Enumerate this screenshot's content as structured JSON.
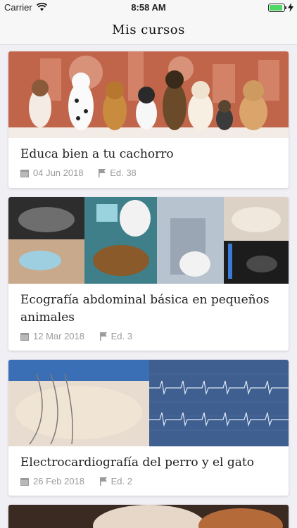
{
  "status": {
    "carrier": "Carrier",
    "time": "8:58 AM",
    "battery_level": 0.9
  },
  "nav": {
    "title": "Mis cursos"
  },
  "courses": [
    {
      "title": "Educa bien a tu cachorro",
      "date": "04 Jun 2018",
      "edition": "Ed. 38"
    },
    {
      "title": "Ecografía abdominal básica en pequeños animales",
      "date": "12 Mar 2018",
      "edition": "Ed. 3"
    },
    {
      "title": "Electrocardiografía del perro y el gato",
      "date": "26 Feb 2018",
      "edition": "Ed. 2"
    }
  ],
  "colors": {
    "accent": "#c1654a",
    "meta": "#9b9b9b",
    "battery": "#4cd964"
  }
}
